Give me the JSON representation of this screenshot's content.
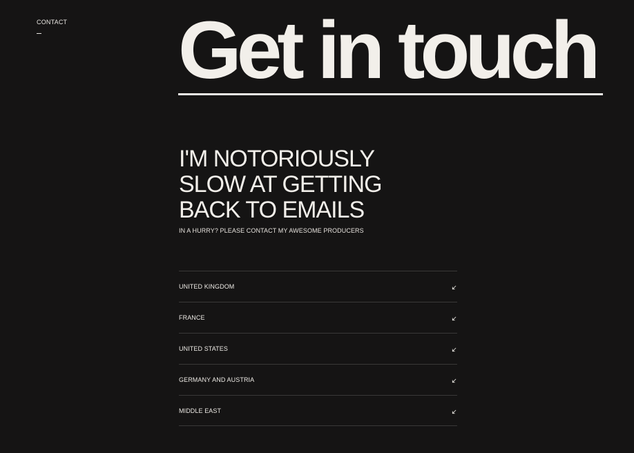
{
  "nav": {
    "section_label": "CONTACT"
  },
  "hero": {
    "title": "Get in touch"
  },
  "intro": {
    "headline_lines": [
      "I'M NOTORIOUSLY",
      "SLOW AT GETTING",
      "BACK TO EMAILS"
    ],
    "subtext": "IN A HURRY? PLEASE CONTACT MY AWESOME PRODUCERS"
  },
  "producers": [
    {
      "region": "UNITED KINGDOM",
      "icon": "arrow-down-left-icon"
    },
    {
      "region": "FRANCE",
      "icon": "arrow-down-left-icon"
    },
    {
      "region": "UNITED STATES",
      "icon": "arrow-down-left-icon"
    },
    {
      "region": "GERMANY AND AUSTRIA",
      "icon": "arrow-down-left-icon"
    },
    {
      "region": "MIDDLE EAST",
      "icon": "arrow-down-left-icon"
    }
  ],
  "colors": {
    "background": "#151414",
    "foreground": "#f2efea",
    "divider": "#3a3938"
  }
}
